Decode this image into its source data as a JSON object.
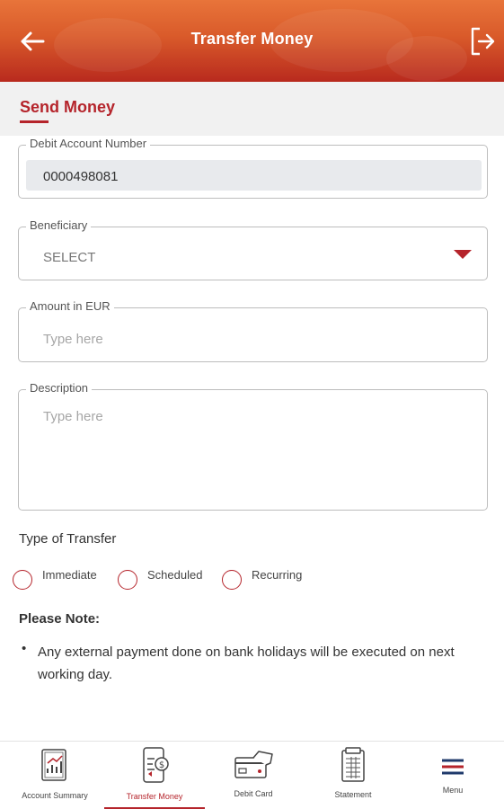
{
  "header": {
    "title": "Transfer Money",
    "back_icon": "arrow-left-icon",
    "logout_icon": "logout-icon"
  },
  "subheader": {
    "title": "Send Money"
  },
  "form": {
    "debit_account": {
      "label": "Debit Account Number",
      "value": "0000498081"
    },
    "beneficiary": {
      "label": "Beneficiary",
      "value": "SELECT"
    },
    "amount": {
      "label": "Amount in EUR",
      "placeholder": "Type here"
    },
    "description": {
      "label": "Description",
      "placeholder": "Type here"
    }
  },
  "transfer_type": {
    "title": "Type of Transfer",
    "options": [
      "Immediate",
      "Scheduled",
      "Recurring"
    ]
  },
  "note": {
    "title": "Please Note:",
    "items": [
      "Any external payment done on bank holidays will be executed on next working day."
    ]
  },
  "bottom_nav": {
    "items": [
      {
        "label": "Account Summary",
        "icon": "account-summary-icon"
      },
      {
        "label": "Transfer Money",
        "icon": "transfer-money-icon"
      },
      {
        "label": "Debit Card",
        "icon": "debit-card-icon"
      },
      {
        "label": "Statement",
        "icon": "statement-icon"
      },
      {
        "label": "Menu",
        "icon": "hamburger-menu-icon"
      }
    ],
    "active_index": 1
  },
  "colors": {
    "accent": "#b5242b",
    "header_top": "#e8743a",
    "header_bottom": "#b82a1e"
  }
}
